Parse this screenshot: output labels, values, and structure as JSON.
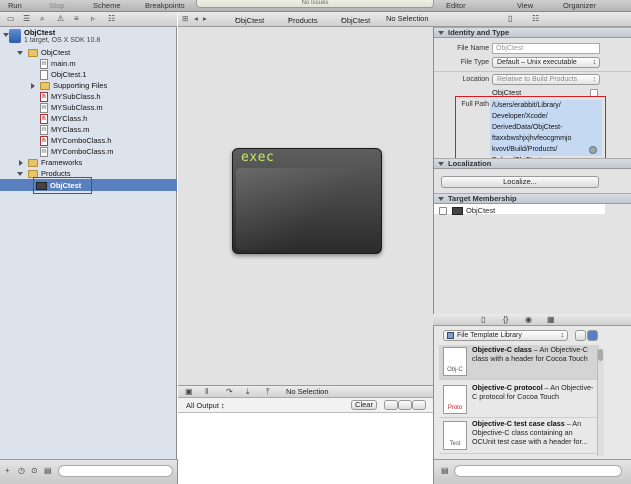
{
  "toolbar": {
    "run": "Run",
    "stop": "Stop",
    "scheme": "Scheme",
    "breakpoints": "Breakpoints",
    "activity": "No Issues",
    "editor": "Editor",
    "view": "View",
    "organizer": "Organizer"
  },
  "navigator": {
    "project_name": "ObjCtest",
    "project_subtitle": "1 target, OS X SDK 10.8",
    "items": [
      {
        "label": "ObjCtest",
        "kind": "folder"
      },
      {
        "label": "main.m",
        "kind": "m"
      },
      {
        "label": "ObjCtest.1",
        "kind": "doc"
      },
      {
        "label": "Supporting Files",
        "kind": "folder"
      },
      {
        "label": "MYSubClass.h",
        "kind": "h"
      },
      {
        "label": "MYSubClass.m",
        "kind": "m"
      },
      {
        "label": "MYClass.h",
        "kind": "h"
      },
      {
        "label": "MYClass.m",
        "kind": "m"
      },
      {
        "label": "MYComboClass.h",
        "kind": "h"
      },
      {
        "label": "MYComboClass.m",
        "kind": "m"
      },
      {
        "label": "Frameworks",
        "kind": "folder"
      },
      {
        "label": "Products",
        "kind": "folder"
      },
      {
        "label": "ObjCtest",
        "kind": "exec",
        "selected": true
      }
    ]
  },
  "jumpbar": {
    "crumb1": "ObjCtest",
    "crumb2": "Products",
    "crumb3": "ObjCtest",
    "crumb4": "No Selection"
  },
  "editor": {
    "exec_label": "exec"
  },
  "debug": {
    "selection": "No Selection",
    "output_filter": "All Output ↕",
    "clear_label": "Clear"
  },
  "inspector": {
    "identity_header": "Identity and Type",
    "file_name_label": "File Name",
    "file_name_placeholder": "ObjCtest",
    "file_type_label": "File Type",
    "file_type_value": "Default – Unix executable",
    "location_label": "Location",
    "location_value": "Relative to Build Products",
    "location_file": "ObjCtest",
    "full_path_label": "Full Path",
    "full_path_lines": [
      "/Users/erabbit/Library/",
      "Developer/Xcode/",
      "DerivedData/ObjCtest-",
      "ftaxxbwshjxjhvfeocgmmjo",
      "kvovt/Build/Products/",
      "Debug/ObjCtest"
    ],
    "localization_header": "Localization",
    "localize_button": "Localize...",
    "target_header": "Target Membership",
    "target_item": "ObjCtest"
  },
  "library": {
    "selector": "File Template Library",
    "items": [
      {
        "title": "Objective-C class",
        "desc": " – An Objective-C class with a header for Cocoa Touch",
        "icon": "Obj-C"
      },
      {
        "title": "Objective-C protocol",
        "desc": " – An Objective-C protocol for Cocoa Touch",
        "icon": "Proto"
      },
      {
        "title": "Objective-C test case class",
        "desc": " – An Objective-C class containing an OCUnit test case with a header for...",
        "icon": "Test"
      }
    ]
  },
  "colors": {
    "selection": "#5a7fbf",
    "highlight_box": "#d81c22",
    "exec_text": "#c6e86c"
  }
}
